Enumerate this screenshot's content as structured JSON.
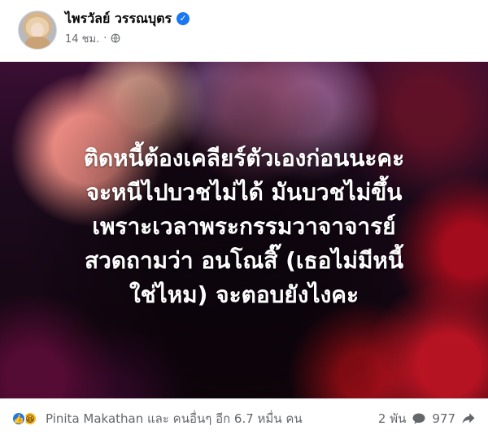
{
  "post": {
    "author_name": "ไพรวัลย์ วรรณบุตร",
    "verified_icon": "verified-badge-icon",
    "timestamp": "14 ชม.",
    "separator": "·",
    "privacy_icon": "globe-icon",
    "text_lines": [
      "ติดหนี้ต้องเคลียร์ตัวเองก่อนนะคะ",
      "จะหนีไปบวชไม่ได้ มันบวชไม่ขึ้น",
      "เพราะเวลาพระกรรมวาจาจารย์",
      "สวดถามว่า อนโณสิ๊ (เธอไม่มีหนี้",
      "ใช่ไหม) จะตอบยังไงคะ"
    ]
  },
  "footer": {
    "reaction_icons": [
      "like-icon",
      "haha-icon"
    ],
    "reaction_summary": "Pinita Makathan และ คนอื่นๆ อีก 6.7 หมื่น คน",
    "comments_count": "2 พัน",
    "shares_count": "977"
  },
  "colors": {
    "accent": "#1877f2",
    "muted_text": "#65676b",
    "text": "#050505",
    "post_text": "#ffffff"
  }
}
